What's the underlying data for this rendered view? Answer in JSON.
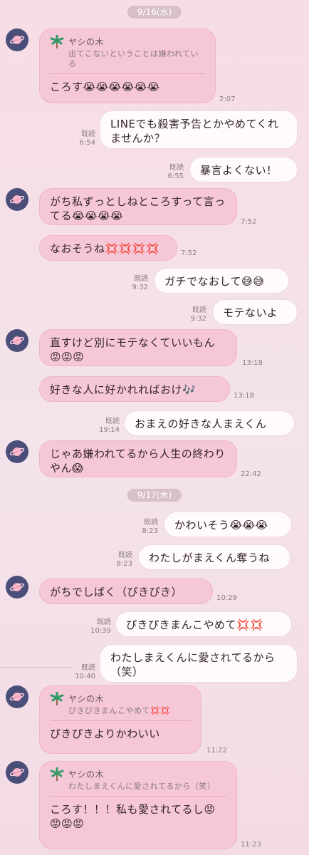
{
  "dates": {
    "d1": "9/16(水)",
    "d2": "9/17(木)"
  },
  "colors": {
    "incoming": "#f6c7d6",
    "outgoing": "#fffafb",
    "avatar": "#4a4f7a"
  },
  "messages": {
    "m1": {
      "reply_name": "ヤシの木",
      "reply_text": "出てこないということは嫌われている",
      "text": "ころす😭😭😭😭😭😭",
      "time": "2:07"
    },
    "m2": {
      "text": "LINEでも殺害予告とかやめてくれませんか？",
      "read": "既読",
      "time": "6:54"
    },
    "m3": {
      "text": "暴言よくない！",
      "read": "既読",
      "time": "6:55"
    },
    "m4": {
      "text": "がち私ずっとしねところすって言ってる😭😭😭😭",
      "time": "7:52"
    },
    "m5": {
      "text": "なおそうね💢💢💢💢",
      "time": "7:52"
    },
    "m6": {
      "text": "ガチでなおして😅😅",
      "read": "既読",
      "time": "9:32"
    },
    "m7": {
      "text": "モテないよ",
      "read": "既読",
      "time": "9:32"
    },
    "m8": {
      "text": "直すけど別にモテなくていいもん😡😡😡",
      "time": "13:18"
    },
    "m9": {
      "text": "好きな人に好かれればおけ🎶",
      "time": "13:18"
    },
    "m10": {
      "text": "おまえの好きな人まえくん",
      "read": "既読",
      "time": "19:14"
    },
    "m11": {
      "text": "じゃあ嫌われてるから人生の終わりやん😱",
      "time": "22:42"
    },
    "m12": {
      "text": "かわいそう😭😭😭",
      "read": "既読",
      "time": "8:23"
    },
    "m13": {
      "text": "わたしがまえくん奪うね",
      "read": "既読",
      "time": "8:23"
    },
    "m14": {
      "text": "がちでしばく（ぴきぴき）",
      "time": "10:29"
    },
    "m15": {
      "text": "ぴきぴきまんこやめて💢💢",
      "read": "既読",
      "time": "10:39"
    },
    "m16": {
      "text": "わたしまえくんに愛されてるから（笑）",
      "read": "既読",
      "time": "10:40"
    },
    "m17": {
      "reply_name": "ヤシの木",
      "reply_text": "ぴきぴきまんこやめて💢💢",
      "text": "ぴきぴきよりかわいい",
      "time": "11:22"
    },
    "m18": {
      "reply_name": "ヤシの木",
      "reply_text": "わたしまえくんに愛されてるから（笑）",
      "text": "ころす！！！私も愛されてるし😡😡😡😡",
      "time": "11:23"
    }
  }
}
